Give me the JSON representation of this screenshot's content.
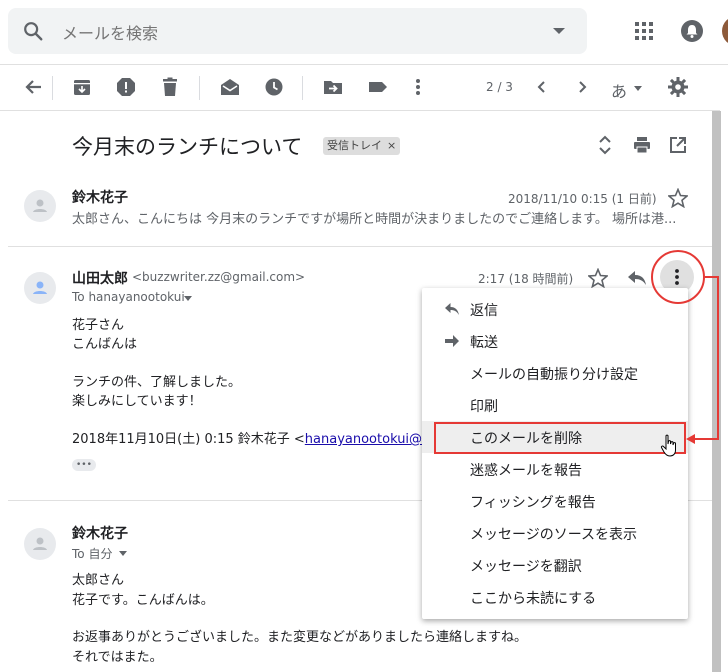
{
  "search": {
    "placeholder": "メールを検索"
  },
  "toolbar": {
    "pager": "2 / 3",
    "input_mode": "あ"
  },
  "thread": {
    "subject": "今月末のランチについて",
    "label": "受信トレイ",
    "label_close": "×"
  },
  "messages": [
    {
      "sender": "鈴木花子",
      "date": "2018/11/10 0:15 (1 日前)",
      "snippet": "太郎さん、こんにちは 今月末のランチですが場所と時間が決まりましたのでご連絡します。 場所は港..."
    },
    {
      "sender": "山田太郎",
      "email": "<buzzwriter.zz@gmail.com>",
      "to": "To hanayanootokui",
      "time": "2:17 (18 時間前)",
      "body": [
        "花子さん",
        "こんばんは",
        "",
        "ランチの件、了解しました。",
        "楽しみにしています！"
      ],
      "quote_prefix": "2018年11月10日(土) 0:15 鈴木花子 <",
      "quote_link": "hanayanootokui@gmail",
      "ellipsis": "•••"
    },
    {
      "sender": "鈴木花子",
      "to": "To 自分",
      "body": [
        "太郎さん",
        "花子です。こんばんは。",
        "",
        "お返事ありがとうございました。また変更などがありましたら連絡しますね。",
        "それではまた。"
      ]
    }
  ],
  "menu": {
    "items": [
      {
        "label": "返信",
        "icon": "reply-icon"
      },
      {
        "label": "転送",
        "icon": "forward-icon"
      },
      {
        "label": "メールの自動振り分け設定"
      },
      {
        "label": "印刷"
      },
      {
        "label": "このメールを削除",
        "highlighted": true
      },
      {
        "label": "迷惑メールを報告"
      },
      {
        "label": "フィッシングを報告"
      },
      {
        "label": "メッセージのソースを表示"
      },
      {
        "label": "メッセージを翻訳"
      },
      {
        "label": "ここから未読にする"
      }
    ]
  },
  "colors": {
    "accent_red": "#e53935",
    "icon_gray": "#5f6368"
  }
}
